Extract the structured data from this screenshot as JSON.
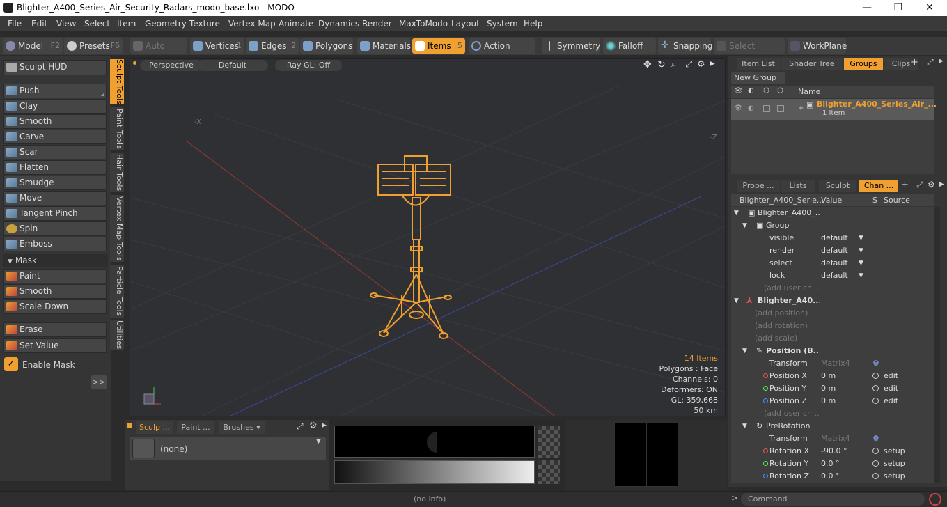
{
  "window": {
    "title": "Blighter_A400_Series_Air_Security_Radars_modo_base.lxo - MODO",
    "minimize": "—",
    "maximize": "❐",
    "close": "✕"
  },
  "menu": [
    "File",
    "Edit",
    "View",
    "Select",
    "Item",
    "Geometry",
    "Texture",
    "Vertex Map",
    "Animate",
    "Dynamics",
    "Render",
    "MaxToModo",
    "Layout",
    "System",
    "Help"
  ],
  "toolbar": {
    "model": "Model",
    "model_key": "F2",
    "presets": "Presets",
    "presets_key": "F6",
    "auto_select": "Auto Select",
    "vertices": "Vertices",
    "vertices_key": "1",
    "edges": "Edges",
    "edges_key": "2",
    "polygons": "Polygons",
    "materials": "Materials",
    "items": "Items",
    "items_key": "5",
    "action_center": "Action Center",
    "symmetry": "Symmetry",
    "falloff": "Falloff",
    "snapping": "Snapping",
    "select_through": "Select Through",
    "workplane": "WorkPlane"
  },
  "left": {
    "sculpt_hud": "Sculpt HUD",
    "tools": [
      "Push",
      "Clay",
      "Smooth",
      "Carve",
      "Scar",
      "Flatten",
      "Smudge",
      "Move",
      "Tangent Pinch",
      "Spin",
      "Emboss"
    ],
    "mask_header": "Mask",
    "mask_tools": [
      "Paint",
      "Smooth",
      "Scale Down"
    ],
    "erase": "Erase",
    "set_value": "Set Value",
    "enable_mask": "Enable Mask",
    "more": ">>"
  },
  "vtabs": [
    "Sculpt Tools",
    "Paint Tools",
    "Hair Tools",
    "Vertex Map Tools",
    "Particle Tools",
    "Utilities"
  ],
  "viewport": {
    "view": "Perspective",
    "shading": "Default",
    "raygl": "Ray GL: Off",
    "axis_x_neg": "-X",
    "axis_z_neg": "-Z",
    "stats": {
      "items": "14 Items",
      "polygons": "Polygons : Face",
      "channels": "Channels: 0",
      "deformers": "Deformers: ON",
      "gl": "GL: 359,668",
      "scale": "50 km"
    },
    "colors": {
      "wire": "#f0a030",
      "grid": "#3a3c40"
    }
  },
  "bottom": {
    "tab1": "Sculp ...",
    "tab2": "Paint ...",
    "tab3": "Brushes",
    "brush": "(none)"
  },
  "right": {
    "tabs_top": [
      "Item List",
      "Shader Tree",
      "Groups",
      "Clips"
    ],
    "new_group": "New Group",
    "col_name": "Name",
    "group_name": "Blighter_A400_Series_Air_...",
    "group_count": "1 Item",
    "tabs_mid": [
      "Prope ...",
      "Lists",
      "Sculpt",
      "Chan ..."
    ],
    "chan_header": {
      "name": "Blighter_A400_Serie...",
      "value": "Value",
      "s": "S",
      "source": "Source"
    },
    "rows": [
      {
        "label": "Blighter_A400_...",
        "value": "",
        "source": ""
      },
      {
        "label": "Group",
        "value": "",
        "source": ""
      },
      {
        "label": "visible",
        "value": "default",
        "source": ""
      },
      {
        "label": "render",
        "value": "default",
        "source": ""
      },
      {
        "label": "select",
        "value": "default",
        "source": ""
      },
      {
        "label": "lock",
        "value": "default",
        "source": ""
      },
      {
        "label": "(add user ch ...",
        "value": "",
        "source": ""
      },
      {
        "label": "Blighter_A40...",
        "value": "",
        "source": ""
      },
      {
        "label": "(add position)",
        "value": "",
        "source": ""
      },
      {
        "label": "(add rotation)",
        "value": "",
        "source": ""
      },
      {
        "label": "(add scale)",
        "value": "",
        "source": ""
      },
      {
        "label": "Position (B...",
        "value": "",
        "source": ""
      },
      {
        "label": "Transform",
        "value": "Matrix4",
        "source": ""
      },
      {
        "label": "Position X",
        "value": "0 m",
        "source": "edit"
      },
      {
        "label": "Position Y",
        "value": "0 m",
        "source": "edit"
      },
      {
        "label": "Position Z",
        "value": "0 m",
        "source": "edit"
      },
      {
        "label": "(add user ch ...",
        "value": "",
        "source": ""
      },
      {
        "label": "PreRotation",
        "value": "",
        "source": ""
      },
      {
        "label": "Transform",
        "value": "Matrix4",
        "source": ""
      },
      {
        "label": "Rotation X",
        "value": "-90.0 °",
        "source": "setup"
      },
      {
        "label": "Rotation Y",
        "value": "0.0 °",
        "source": "setup"
      },
      {
        "label": "Rotation Z",
        "value": "0.0 °",
        "source": "setup"
      }
    ],
    "command": "Command"
  },
  "status": {
    "info": "(no info)"
  }
}
